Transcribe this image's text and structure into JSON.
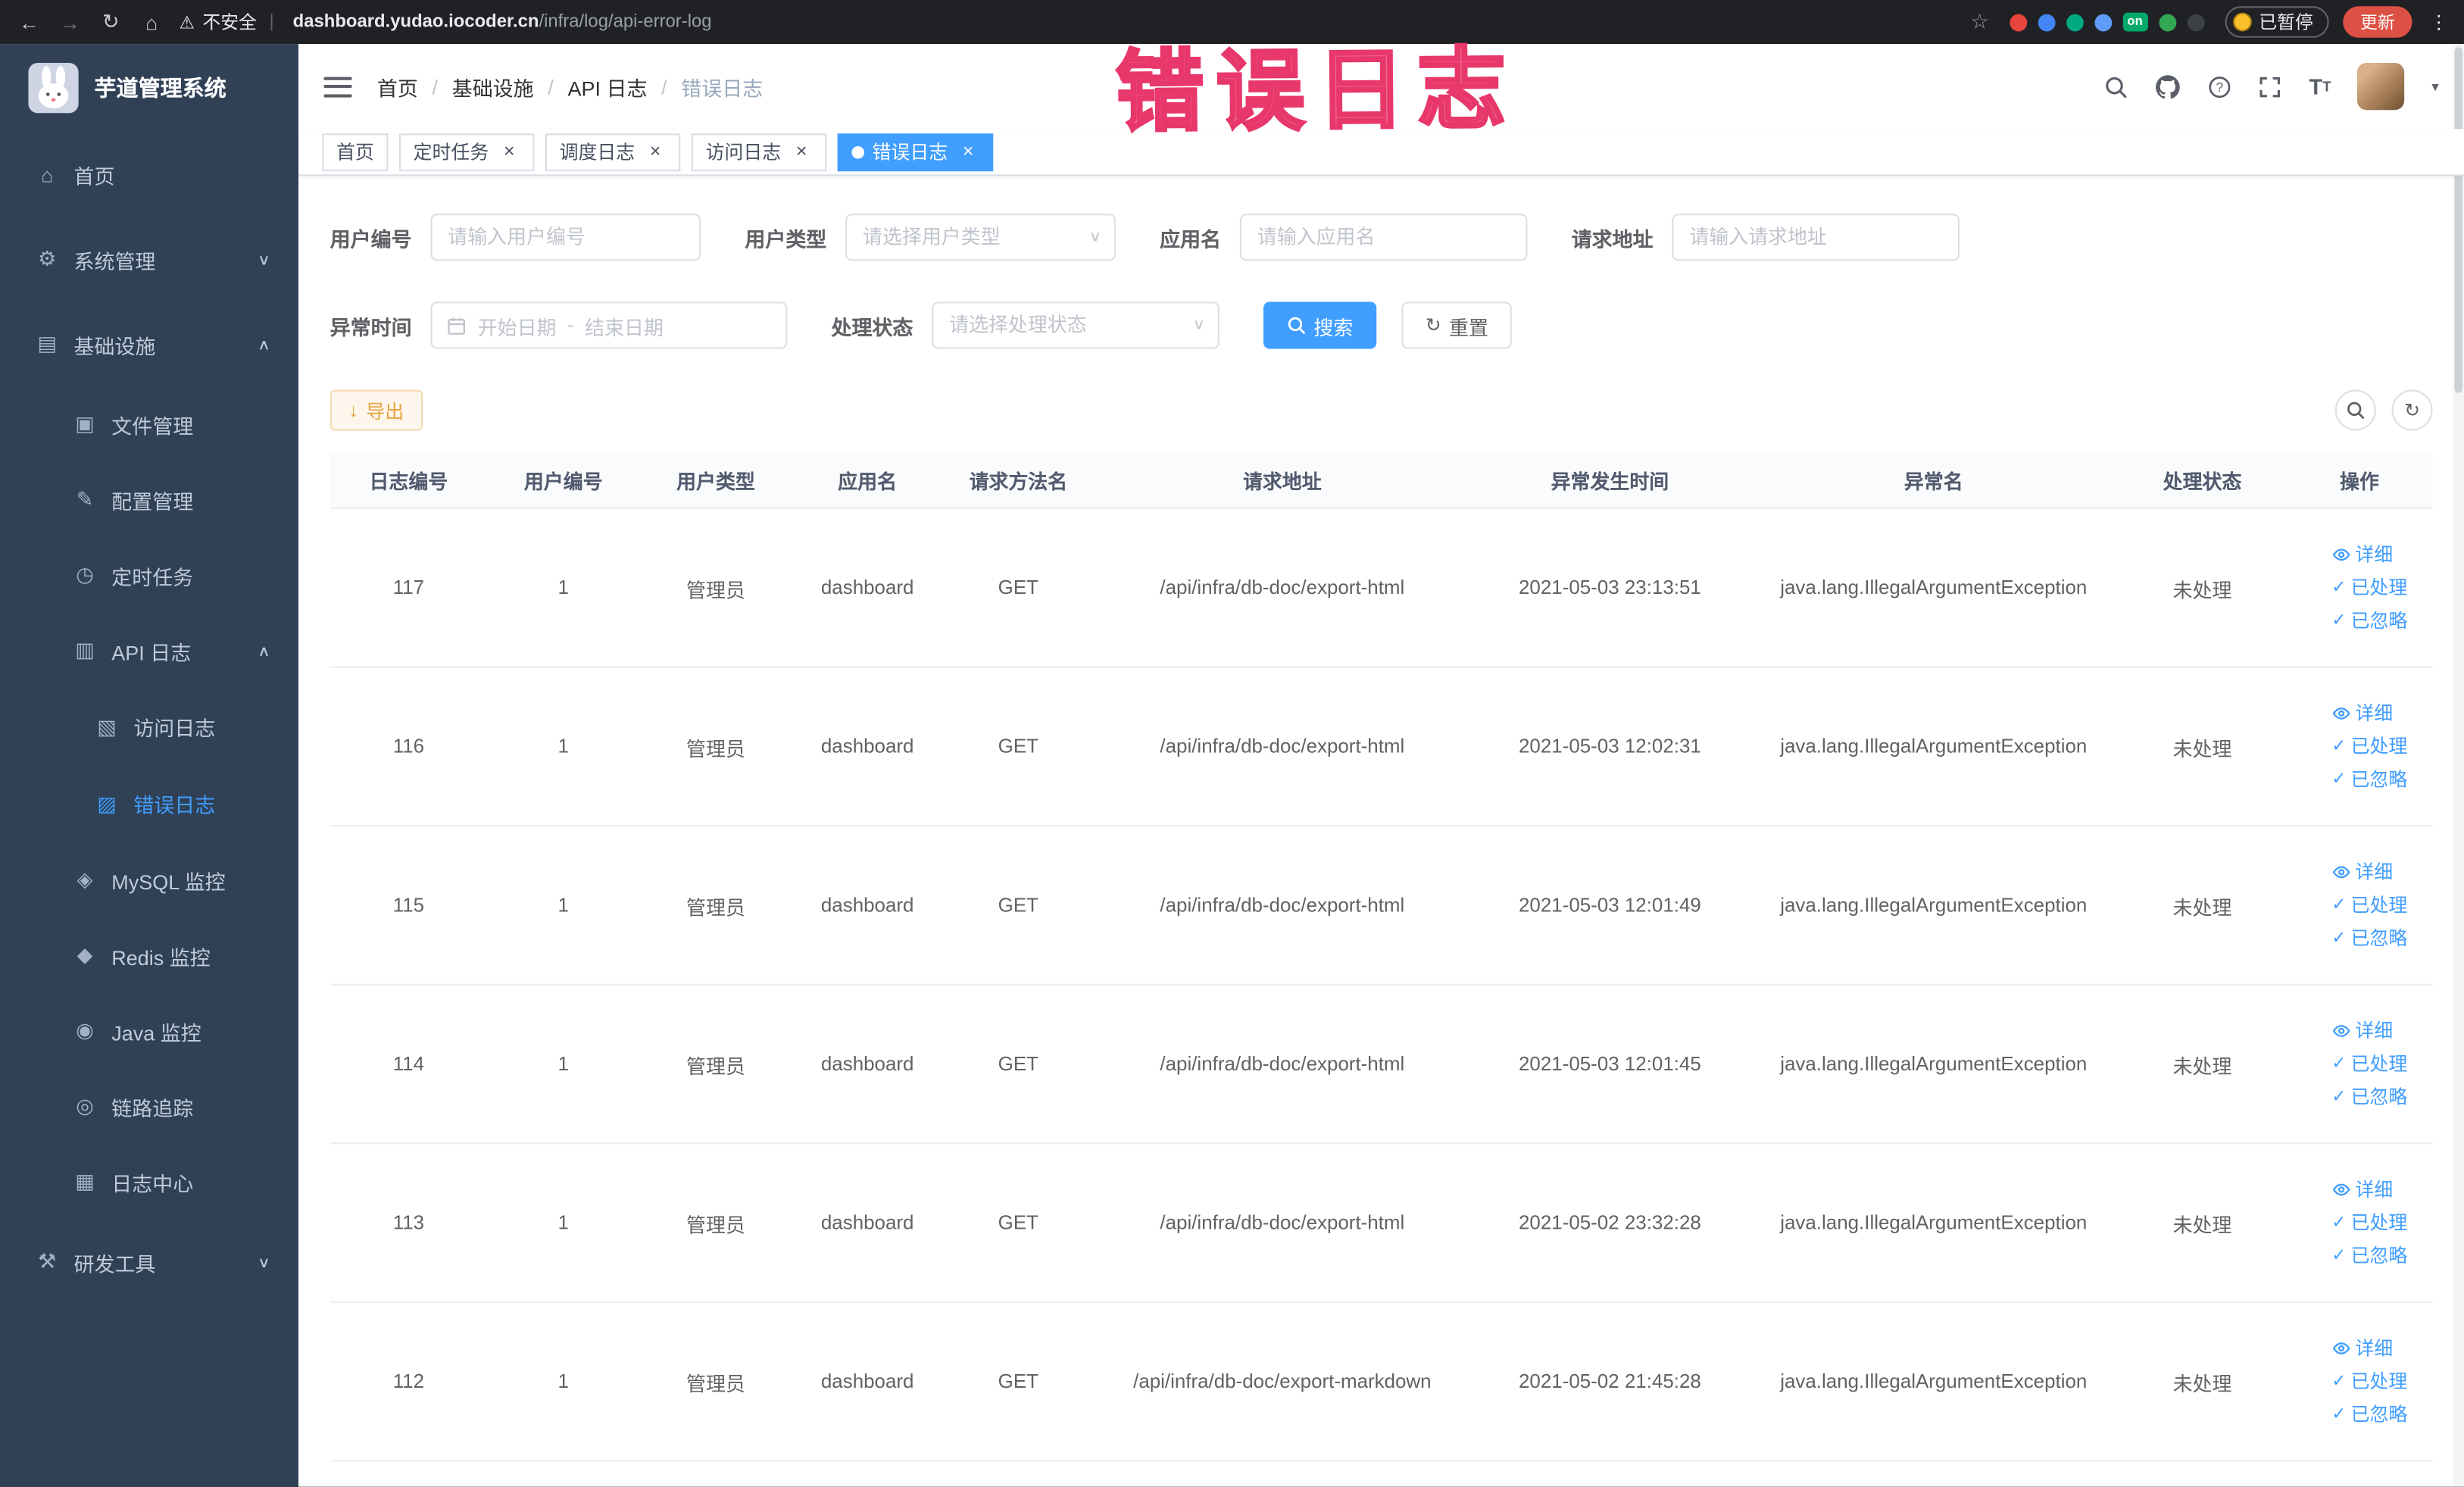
{
  "colors": {
    "primary": "#409eff",
    "sidebar_bg": "#304156",
    "active_tab_bg": "#409eff",
    "warning_button": "#e6a23c",
    "annotation_pink": "#e8376b",
    "chrome_bg": "#202124"
  },
  "browser": {
    "security_warning": "不安全",
    "url_domain": "dashboard.yudao.iocoder.cn",
    "url_path": "/infra/log/api-error-log",
    "paused_badge": "已暂停",
    "update_button": "更新",
    "extensions": [
      {
        "name": "extension-target-icon",
        "color": "#e8453c"
      },
      {
        "name": "extension-drop-icon",
        "color": "#4285f4"
      },
      {
        "name": "extension-v-icon",
        "color": "#00a97f"
      },
      {
        "name": "extension-grid-icon",
        "color": "#5f9bf7"
      },
      {
        "name": "extension-on-badge",
        "color": "#00a86b",
        "label": "on"
      },
      {
        "name": "extension-leaf-icon",
        "color": "#34a853"
      },
      {
        "name": "extension-paw-icon",
        "color": "#3c4043"
      }
    ]
  },
  "annotation": {
    "text": "错误日志"
  },
  "sidebar": {
    "logo_title": "芋道管理系统",
    "items": [
      {
        "id": "home",
        "label": "首页",
        "icon": "home-icon",
        "level": 1,
        "chevron": null,
        "active": false
      },
      {
        "id": "system",
        "label": "系统管理",
        "icon": "gear-icon",
        "level": 1,
        "chevron": "down",
        "active": false
      },
      {
        "id": "infrastructure",
        "label": "基础设施",
        "icon": "monitor-icon",
        "level": 1,
        "chevron": "up",
        "active": false
      },
      {
        "id": "file",
        "label": "文件管理",
        "icon": "folder-icon",
        "level": 2,
        "chevron": null,
        "active": false
      },
      {
        "id": "config",
        "label": "配置管理",
        "icon": "edit-icon",
        "level": 2,
        "chevron": null,
        "active": false
      },
      {
        "id": "job",
        "label": "定时任务",
        "icon": "clock-icon",
        "level": 2,
        "chevron": null,
        "active": false
      },
      {
        "id": "api-log",
        "label": "API 日志",
        "icon": "document-icon",
        "level": 2,
        "chevron": "up",
        "active": false
      },
      {
        "id": "access-log",
        "label": "访问日志",
        "icon": "access-log-icon",
        "level": 3,
        "chevron": null,
        "active": false
      },
      {
        "id": "error-log",
        "label": "错误日志",
        "icon": "error-log-icon",
        "level": 3,
        "chevron": null,
        "active": true
      },
      {
        "id": "mysql-monitor",
        "label": "MySQL 监控",
        "icon": "mysql-icon",
        "level": 2,
        "chevron": null,
        "active": false
      },
      {
        "id": "redis-monitor",
        "label": "Redis 监控",
        "icon": "redis-icon",
        "level": 2,
        "chevron": null,
        "active": false
      },
      {
        "id": "java-monitor",
        "label": "Java 监控",
        "icon": "java-icon",
        "level": 2,
        "chevron": null,
        "active": false
      },
      {
        "id": "trace",
        "label": "链路追踪",
        "icon": "trace-eye-icon",
        "level": 2,
        "chevron": null,
        "active": false
      },
      {
        "id": "log-center",
        "label": "日志中心",
        "icon": "log-center-icon",
        "level": 2,
        "chevron": null,
        "active": false
      },
      {
        "id": "dev-tools",
        "label": "研发工具",
        "icon": "tools-icon",
        "level": 1,
        "chevron": "down",
        "active": false
      }
    ]
  },
  "header": {
    "breadcrumb": [
      "首页",
      "基础设施",
      "API 日志",
      "错误日志"
    ]
  },
  "tabs": [
    {
      "id": "home",
      "label": "首页",
      "closable": false,
      "active": false
    },
    {
      "id": "job",
      "label": "定时任务",
      "closable": true,
      "active": false
    },
    {
      "id": "job-log",
      "label": "调度日志",
      "closable": true,
      "active": false
    },
    {
      "id": "access-log",
      "label": "访问日志",
      "closable": true,
      "active": false
    },
    {
      "id": "error-log",
      "label": "错误日志",
      "closable": true,
      "active": true
    }
  ],
  "filters": {
    "user_id": {
      "label": "用户编号",
      "placeholder": "请输入用户编号"
    },
    "user_type": {
      "label": "用户类型",
      "placeholder": "请选择用户类型"
    },
    "app_name": {
      "label": "应用名",
      "placeholder": "请输入应用名"
    },
    "request_url": {
      "label": "请求地址",
      "placeholder": "请输入请求地址"
    },
    "exception_time": {
      "label": "异常时间",
      "start_placeholder": "开始日期",
      "separator": "-",
      "end_placeholder": "结束日期"
    },
    "process_status": {
      "label": "处理状态",
      "placeholder": "请选择处理状态"
    },
    "search_button": "搜索",
    "reset_button": "重置"
  },
  "toolbar": {
    "export_label": "导出"
  },
  "table": {
    "columns": [
      "日志编号",
      "用户编号",
      "用户类型",
      "应用名",
      "请求方法名",
      "请求地址",
      "异常发生时间",
      "异常名",
      "处理状态",
      "操作"
    ],
    "row_actions": [
      {
        "id": "detail",
        "label": "详细",
        "icon": "eye-icon"
      },
      {
        "id": "processed",
        "label": "已处理",
        "icon": "check-icon"
      },
      {
        "id": "ignored",
        "label": "已忽略",
        "icon": "check-icon"
      }
    ],
    "rows": [
      {
        "log_id": "117",
        "user_id": "1",
        "user_type": "管理员",
        "app_name": "dashboard",
        "method": "GET",
        "request_url": "/api/infra/db-doc/export-html",
        "time": "2021-05-03 23:13:51",
        "exception": "java.lang.IllegalArgumentException",
        "status": "未处理"
      },
      {
        "log_id": "116",
        "user_id": "1",
        "user_type": "管理员",
        "app_name": "dashboard",
        "method": "GET",
        "request_url": "/api/infra/db-doc/export-html",
        "time": "2021-05-03 12:02:31",
        "exception": "java.lang.IllegalArgumentException",
        "status": "未处理"
      },
      {
        "log_id": "115",
        "user_id": "1",
        "user_type": "管理员",
        "app_name": "dashboard",
        "method": "GET",
        "request_url": "/api/infra/db-doc/export-html",
        "time": "2021-05-03 12:01:49",
        "exception": "java.lang.IllegalArgumentException",
        "status": "未处理"
      },
      {
        "log_id": "114",
        "user_id": "1",
        "user_type": "管理员",
        "app_name": "dashboard",
        "method": "GET",
        "request_url": "/api/infra/db-doc/export-html",
        "time": "2021-05-03 12:01:45",
        "exception": "java.lang.IllegalArgumentException",
        "status": "未处理"
      },
      {
        "log_id": "113",
        "user_id": "1",
        "user_type": "管理员",
        "app_name": "dashboard",
        "method": "GET",
        "request_url": "/api/infra/db-doc/export-html",
        "time": "2021-05-02 23:32:28",
        "exception": "java.lang.IllegalArgumentException",
        "status": "未处理"
      },
      {
        "log_id": "112",
        "user_id": "1",
        "user_type": "管理员",
        "app_name": "dashboard",
        "method": "GET",
        "request_url": "/api/infra/db-doc/export-markdown",
        "time": "2021-05-02 21:45:28",
        "exception": "java.lang.IllegalArgumentException",
        "status": "未处理"
      }
    ]
  }
}
